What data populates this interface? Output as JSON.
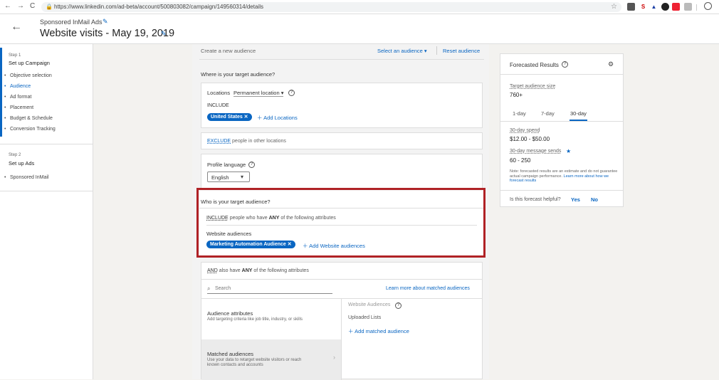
{
  "browser": {
    "url": "https://www.linkedin.com/ad-beta/account/500803082/campaign/149560314/details",
    "back_icon": "←",
    "forward_icon": "→",
    "reload_icon": "C",
    "star_icon": "☆"
  },
  "header": {
    "campaign_type": "Sponsored InMail Ads",
    "campaign_name": "Website visits - May 19, 2019"
  },
  "steps": [
    {
      "label": "Step 1",
      "title": "Set up Campaign",
      "items": [
        "Objective selection",
        "Audience",
        "Ad format",
        "Placement",
        "Budget & Schedule",
        "Conversion Tracking"
      ],
      "active_item": "Audience"
    },
    {
      "label": "Step 2",
      "title": "Set up Ads",
      "items": [
        "Sponsored InMail"
      ]
    }
  ],
  "audience": {
    "create_new": "Create a new audience",
    "select_audience": "Select an audience",
    "reset": "Reset audience",
    "where_title": "Where is your target audience?",
    "locations_label": "Locations",
    "location_type": "Permanent location",
    "include_label": "INCLUDE",
    "location_pill": "United States",
    "add_locations": "Add Locations",
    "exclude_label": "EXCLUDE",
    "exclude_rest": "people in other locations",
    "profile_language_label": "Profile language",
    "language_value": "English",
    "who_title": "Who is your target audience?",
    "include_word": "INCLUDE",
    "people_who_have": "people who have",
    "any_word": "ANY",
    "of_following": "of the following attributes",
    "website_audiences_label": "Website audiences",
    "website_pill": "Marketing Automation Audience",
    "add_website_audiences": "Add Website audiences",
    "and_word": "AND",
    "also_have": "also have",
    "search_placeholder": "Search",
    "learn_more_matched": "Learn more about matched audiences",
    "attributes_title": "Audience attributes",
    "attributes_desc": "Add targeting criteria like job title, industry, or skills",
    "matched_title": "Matched audiences",
    "matched_desc": "Use your data to retarget website visitors or reach known contacts and accounts",
    "website_audiences_header": "Website Audiences",
    "uploaded_lists": "Uploaded Lists",
    "add_matched_audience": "Add matched audience"
  },
  "forecast": {
    "title": "Forecasted Results",
    "target_size_label": "Target audience size",
    "target_size_value": "760+",
    "tabs": [
      "1-day",
      "7-day",
      "30-day"
    ],
    "active_tab": "30-day",
    "spend_label": "30-day spend",
    "spend_value": "$12.00 - $50.00",
    "sends_label": "30-day message sends",
    "sends_value": "60 - 250",
    "note": "Note: forecasted results are an estimate and do not guarantee actual campaign performance.",
    "learn_more": "Learn more about how we forecast results",
    "helpful_question": "Is this forecast helpful?",
    "yes": "Yes",
    "no": "No"
  },
  "colors": {
    "accent": "#0a66c2",
    "highlight_border": "#b02226"
  }
}
